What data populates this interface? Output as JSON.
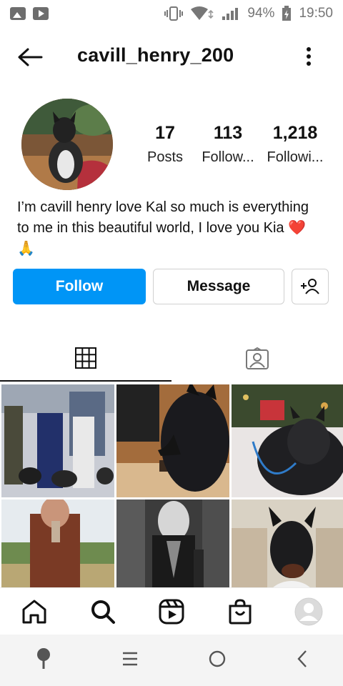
{
  "status_bar": {
    "battery": "94%",
    "time": "19:50"
  },
  "header": {
    "username": "cavill_henry_200"
  },
  "profile": {
    "stats": [
      {
        "value": "17",
        "label": "Posts"
      },
      {
        "value": "113",
        "label": "Follow..."
      },
      {
        "value": "1,218",
        "label": "Followi..."
      }
    ],
    "bio_line1": "I’m cavill henry love Kal so much is everything",
    "bio_line2": "to me in this beautiful world, I love you Kia ❤️",
    "bio_line3": "🙏"
  },
  "actions": {
    "follow_label": "Follow",
    "message_label": "Message"
  },
  "tabs": [
    {
      "icon": "grid-icon",
      "active": true
    },
    {
      "icon": "tagged-icon",
      "active": false
    }
  ],
  "bottom_nav": [
    "home-icon",
    "search-icon",
    "reels-icon",
    "shop-icon",
    "profile-avatar"
  ],
  "colors": {
    "accent": "#0095f6"
  }
}
